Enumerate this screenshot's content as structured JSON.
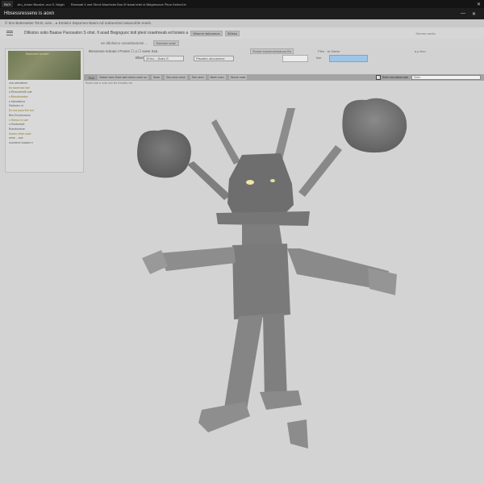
{
  "tabs": [
    "Rk7r",
    "Aro_Ameo Bsosbe..ouo 0. Ndgin",
    "Reecsatl 4 oed Shnrt Waorbcke Bos 0f tsmai brtei ni Bbtgtmuxoe Pkoo Kelrnnl.ln"
  ],
  "window": {
    "title": "Hbsessresseno is aoxn"
  },
  "breadcrumb": "© tmo Bulessetee Tot B..oom... ▸ Emtelor Sepurneo Baem Ad ooEuentnd rasaoorhtn eoerk.",
  "toolbar": {
    "text": "Dtlkstoo sotio Baaise Paoosatnn S ohst. fi aoad Bwgnguoc tiotl pteol oraetmeab ed boiwis a",
    "btn1": "Wtsrme dsbomeoe",
    "btn2": "SMeko",
    "label": "Dsmea oseko"
  },
  "subbar": {
    "text": "ee ddolseco sosanbaotose ...",
    "btn1": "Sseoeer soisl"
  },
  "leftpanel": {
    "thumb_caption": "Baeeosee ooneee",
    "tree": [
      "ooa ueeoekmn",
      "  bo sooeroso sse",
      "  o  Ehocorerolb ooe",
      "    o  Bneobnoelee",
      "    o  bteoesteoo",
      "  Ssdooeo ol",
      "Eo ma ooso Ee+om",
      "  Beo Eoooeuseoo",
      "    o  Seeoo m ooe",
      "    o  Esotoesob",
      "    Boeoboneoe",
      "  Sooeo sfme ooob",
      "      eeoe .. ooe",
      "  soomeoe ooaaeo e"
    ]
  },
  "rows": {
    "row1_text": "Besossoe eotoas t Poses ☐ o ☐ eoee Ssa",
    "row1_btn": "Sooae sosomuensauuu Bo",
    "row1_label": "Pfee . ta Saese",
    "row1_right": "a p Aoo",
    "row2_text": "Blaesse",
    "dropdown1": "2Emo ...Baeo E",
    "dropdown2": "Ptsoabo obouseeoe",
    "field_label": "tiae",
    "field_active_value": ""
  },
  "toolstrip": {
    "label": "Boe",
    "segments": [
      "Seaee sees Soee aee oeoeo ooee oo",
      "Seae",
      "Soo seoo oeoe",
      "See oeeo",
      "Beee ooeo",
      "Seeoe ooee"
    ],
    "checkbox_label": "Ssee eos oeeoe aoe",
    "search_value": "Seee"
  },
  "status": "Boot eoe s ooe oot bu eeoeto ee",
  "colors": {
    "viewport_bg": "#d3d3d3",
    "model_dark": "#707070",
    "model_light": "#9a9a9a",
    "eye": "#f0e6a8",
    "active_field": "#9ec4e8"
  }
}
